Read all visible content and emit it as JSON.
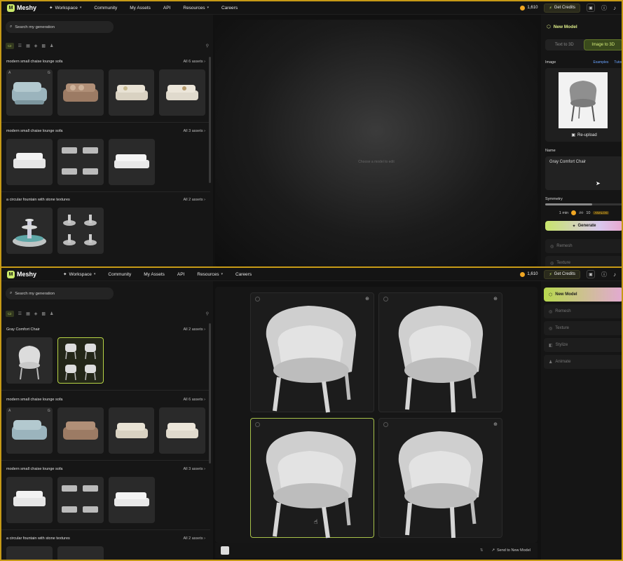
{
  "nav": {
    "logo": "Meshy",
    "workspace": "Workspace",
    "community": "Community",
    "my_assets": "My Assets",
    "api": "API",
    "resources": "Resources",
    "careers": "Careers",
    "credits_top": "1,610",
    "credits_bottom": "1,610",
    "get_credits": "Get Credits"
  },
  "search": {
    "placeholder": "Search my generation"
  },
  "top": {
    "groups": [
      {
        "title": "modern small chaise lounge sofa",
        "all": "All 6 assets",
        "thumb_labels": [
          "A",
          "G"
        ]
      },
      {
        "title": "modern small chaise lounge sofa",
        "all": "All 3 assets"
      },
      {
        "title": "a circular fountain with stone textures",
        "all": "All 2 assets"
      }
    ],
    "center_hint": "Choose a model to edit",
    "right": {
      "new_model": "New Model",
      "tab_text": "Text to 3D",
      "tab_image": "Image to 3D",
      "image_label": "Image",
      "examples": "Examples",
      "tutorial": "Tutori",
      "reupload": "Re-upload",
      "name_label": "Name",
      "name_value": "Gray Comfort Chair",
      "symmetry_label": "Symmetry",
      "time": "1 min",
      "cost_a": "20",
      "cost_b": "10",
      "cost_tag": "ANALOG",
      "generate": "Generate",
      "remesh": "Remesh",
      "texture": "Texture"
    }
  },
  "bottom": {
    "groups": [
      {
        "title": "Gray Comfort Chair",
        "all": "All 2 assets"
      },
      {
        "title": "modern small chaise lounge sofa",
        "all": "All 6 assets",
        "thumb_labels": [
          "A",
          "G"
        ]
      },
      {
        "title": "modern small chaise lounge sofa",
        "all": "All 3 assets"
      },
      {
        "title": "a circular fountain with stone textures",
        "all": "All 2 assets"
      }
    ],
    "right": {
      "new_model": "New Model",
      "remesh": "Remesh",
      "texture": "Texture",
      "stylize": "Stylize",
      "animate": "Animate"
    },
    "send_to": "Send to New Model"
  },
  "colors": {
    "accent": "#c9e86a",
    "frame": "#c79a16",
    "panel": "#161616"
  }
}
